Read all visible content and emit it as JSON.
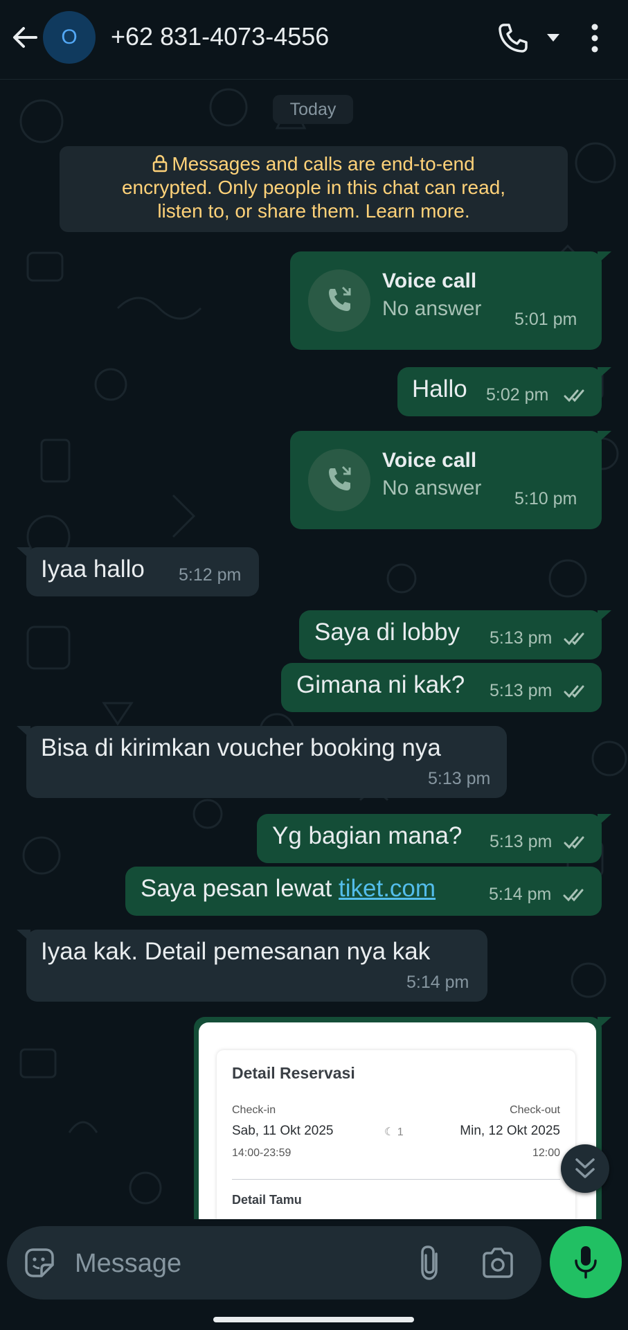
{
  "header": {
    "back_icon": "arrow-left-icon",
    "avatar_letter": "O",
    "contact": "+62 831-4073-4556",
    "call_icon": "phone-icon",
    "dropdown_icon": "caret-down-icon",
    "menu_icon": "more-vertical-icon"
  },
  "chat": {
    "date_label": "Today",
    "encryption_notice": {
      "line1": "Messages and calls are end-to-end",
      "line2": "encrypted. Only people in this chat can read,",
      "line3": "listen to, or share them. Learn more."
    },
    "messages": [
      {
        "type": "call",
        "direction": "out",
        "title": "Voice call",
        "status": "No answer",
        "time": "5:01 pm"
      },
      {
        "type": "text",
        "direction": "out",
        "text": "Hallo",
        "time": "5:02 pm",
        "read": true
      },
      {
        "type": "call",
        "direction": "out",
        "title": "Voice call",
        "status": "No answer",
        "time": "5:10 pm"
      },
      {
        "type": "text",
        "direction": "in",
        "text": "Iyaa hallo",
        "time": "5:12 pm"
      },
      {
        "type": "text",
        "direction": "out",
        "text": "Saya di lobby",
        "time": "5:13 pm",
        "read": true
      },
      {
        "type": "text",
        "direction": "out",
        "text": "Gimana ni kak?",
        "time": "5:13 pm",
        "read": true
      },
      {
        "type": "text",
        "direction": "in",
        "text": "Bisa di kirimkan voucher booking nya",
        "time": "5:13 pm"
      },
      {
        "type": "text",
        "direction": "out",
        "text": "Yg bagian mana?",
        "time": "5:13 pm",
        "read": true
      },
      {
        "type": "text",
        "direction": "out",
        "text": "Saya pesan lewat ",
        "link": "tiket.com",
        "time": "5:14 pm",
        "read": true
      },
      {
        "type": "text",
        "direction": "in",
        "text": "Iyaa kak. Detail pemesanan nya kak",
        "time": "5:14 pm"
      }
    ],
    "image_message": {
      "title": "Detail Reservasi",
      "checkin_label": "Check-in",
      "checkin_date": "Sab, 11 Okt 2025",
      "checkin_time": "14:00-23:59",
      "nights": "1",
      "checkout_label": "Check-out",
      "checkout_date": "Min, 12 Okt 2025",
      "checkout_time": "12:00",
      "guest_section": "Detail Tamu"
    }
  },
  "composer": {
    "placeholder": "Message",
    "emoji_icon": "sticker-icon",
    "attach_icon": "paperclip-icon",
    "camera_icon": "camera-icon",
    "mic_icon": "microphone-icon"
  },
  "colors": {
    "background": "#0b141a",
    "outgoing_bubble": "#144d37",
    "incoming_bubble": "#1f2c34",
    "accent_green": "#21c063",
    "read_ticks": "#a8c2b6",
    "link": "#53bdeb",
    "notice_text": "#ffd279"
  }
}
